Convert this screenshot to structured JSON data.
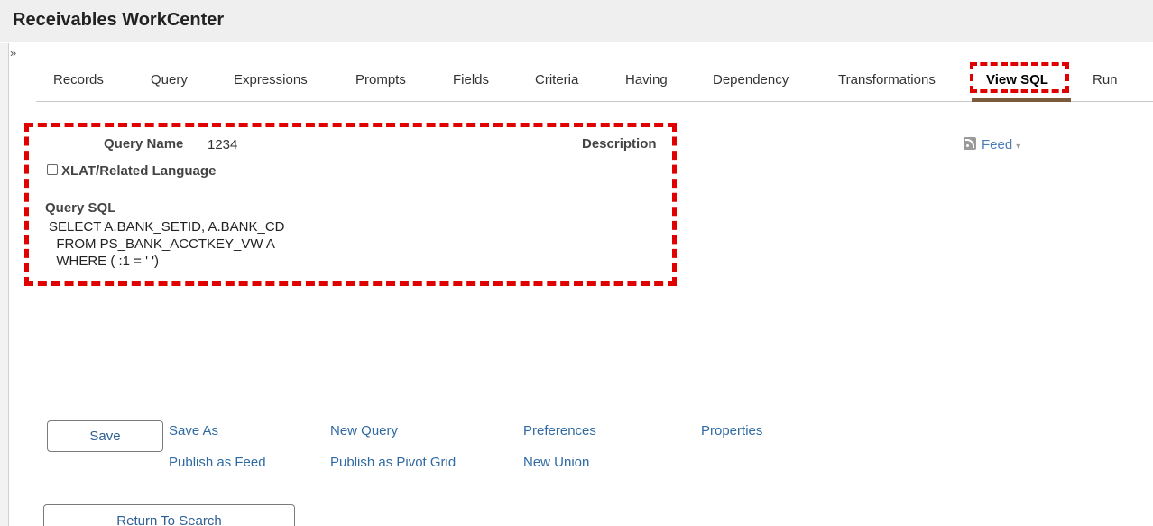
{
  "app": {
    "title": "Receivables WorkCenter",
    "collapse_glyph": "»"
  },
  "tabs": [
    {
      "label": "Records"
    },
    {
      "label": "Query"
    },
    {
      "label": "Expressions"
    },
    {
      "label": "Prompts"
    },
    {
      "label": "Fields"
    },
    {
      "label": "Criteria"
    },
    {
      "label": "Having"
    },
    {
      "label": "Dependency"
    },
    {
      "label": "Transformations"
    },
    {
      "label": "View SQL",
      "active": true
    },
    {
      "label": "Run"
    }
  ],
  "query": {
    "name_label": "Query Name",
    "name_value": "1234",
    "description_label": "Description",
    "xlat_label": "XLAT/Related Language",
    "xlat_checked": false,
    "sql_label": "Query SQL",
    "sql_lines": [
      "SELECT A.BANK_SETID, A.BANK_CD",
      "  FROM PS_BANK_ACCTKEY_VW A",
      "  WHERE ( :1 = ' ')"
    ]
  },
  "feed": {
    "label": "Feed",
    "icon": "rss-feed-icon",
    "caret": "▾"
  },
  "actions": {
    "save": "Save",
    "save_as": "Save As",
    "new_query": "New Query",
    "preferences": "Preferences",
    "properties": "Properties",
    "publish_as_feed": "Publish as Feed",
    "publish_as_pivot_grid": "Publish as Pivot Grid",
    "new_union": "New Union",
    "return_to_search": "Return To Search"
  },
  "colors": {
    "link": "#2f6aa3",
    "highlight": "#e00000",
    "active_tab_underline": "#7a5a3a"
  }
}
